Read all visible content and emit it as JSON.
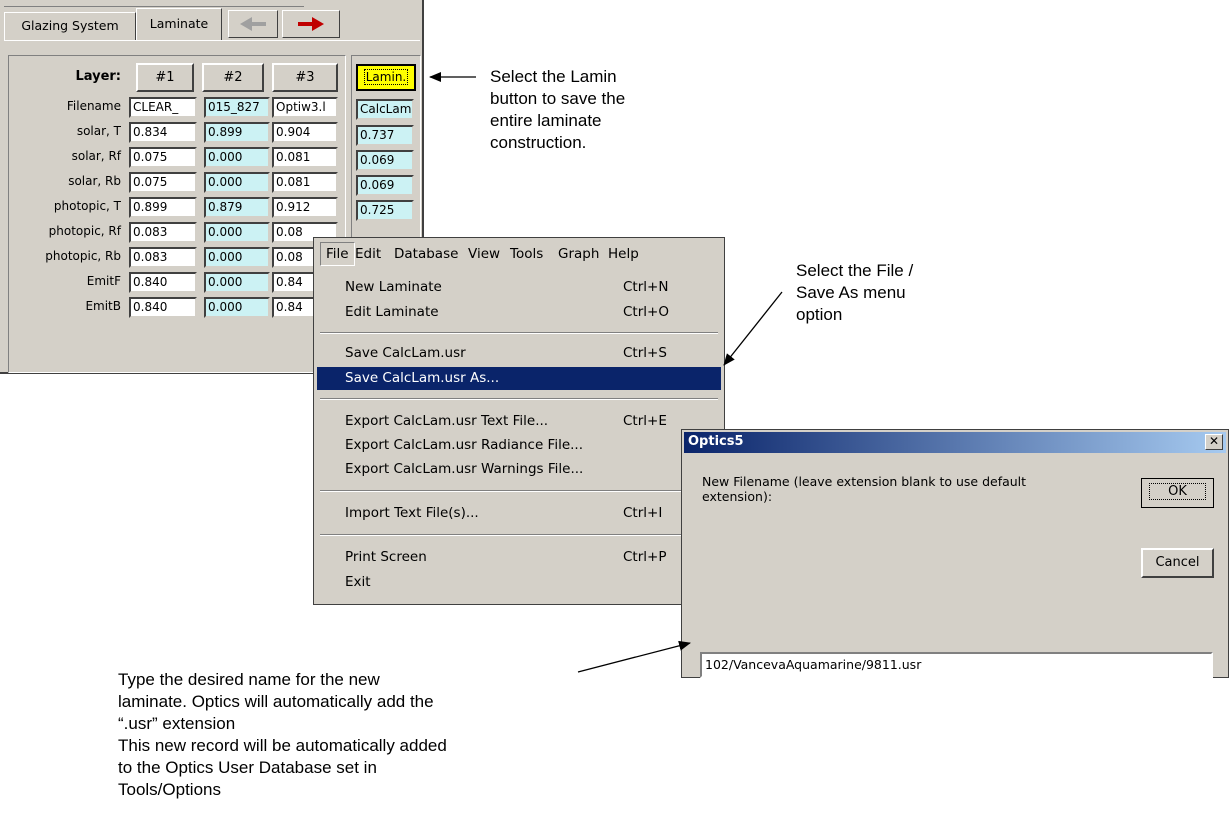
{
  "panel": {
    "tabs": [
      "Glazing System",
      "Laminate"
    ],
    "nav_back": "◆",
    "nav_fwd": "◆",
    "layer_header": "Layer:",
    "columns": [
      "#1",
      "#2",
      "#3"
    ],
    "lamin_button": "Lamin.",
    "rows": [
      {
        "label": "Filename",
        "values": [
          "CLEAR_",
          "015_827",
          "Optiw3.l"
        ],
        "calc": "CalcLam"
      },
      {
        "label": "solar, T",
        "values": [
          "0.834",
          "0.899",
          "0.904"
        ],
        "calc": "0.737"
      },
      {
        "label": "solar, Rf",
        "values": [
          "0.075",
          "0.000",
          "0.081"
        ],
        "calc": "0.069"
      },
      {
        "label": "solar, Rb",
        "values": [
          "0.075",
          "0.000",
          "0.081"
        ],
        "calc": "0.069"
      },
      {
        "label": "photopic, T",
        "values": [
          "0.899",
          "0.879",
          "0.912"
        ],
        "calc": "0.725"
      },
      {
        "label": "photopic, Rf",
        "values": [
          "0.083",
          "0.000",
          "0.08"
        ],
        "calc": ""
      },
      {
        "label": "photopic, Rb",
        "values": [
          "0.083",
          "0.000",
          "0.08"
        ],
        "calc": ""
      },
      {
        "label": "EmitF",
        "values": [
          "0.840",
          "0.000",
          "0.84"
        ],
        "calc": ""
      },
      {
        "label": "EmitB",
        "values": [
          "0.840",
          "0.000",
          "0.84"
        ],
        "calc": ""
      }
    ]
  },
  "menu": {
    "bar": [
      "File",
      "Edit",
      "Database",
      "View",
      "Tools",
      "Graph",
      "Help"
    ],
    "items": [
      {
        "label": "New Laminate",
        "shortcut": "Ctrl+N"
      },
      {
        "label": "Edit Laminate",
        "shortcut": "Ctrl+O"
      },
      {
        "label": "Save CalcLam.usr",
        "shortcut": "Ctrl+S"
      },
      {
        "label": "Save CalcLam.usr As...",
        "shortcut": ""
      },
      {
        "label": "Export CalcLam.usr Text File...",
        "shortcut": "Ctrl+E"
      },
      {
        "label": "Export CalcLam.usr Radiance File...",
        "shortcut": ""
      },
      {
        "label": "Export CalcLam.usr Warnings File...",
        "shortcut": ""
      },
      {
        "label": "Import Text File(s)...",
        "shortcut": "Ctrl+I"
      },
      {
        "label": "Print Screen",
        "shortcut": "Ctrl+P"
      },
      {
        "label": "Exit",
        "shortcut": ""
      }
    ]
  },
  "dialog": {
    "title": "Optics5",
    "close": "✕",
    "prompt": "New Filename (leave extension blank to use default extension):",
    "ok": "OK",
    "cancel": "Cancel",
    "filename_value": "102/VancevaAquamarine/9811.usr"
  },
  "annotations": {
    "lamin_note": [
      "Select the Lamin",
      "button to save the",
      "entire laminate",
      "construction."
    ],
    "menu_note": [
      "Select the File /",
      "Save As menu",
      "option"
    ],
    "name_note": [
      "Type the desired name for the new",
      "laminate. Optics will automatically add the",
      "“.usr” extension",
      "This new record will be automatically added",
      "to the Optics User Database set in",
      "Tools/Options"
    ]
  }
}
